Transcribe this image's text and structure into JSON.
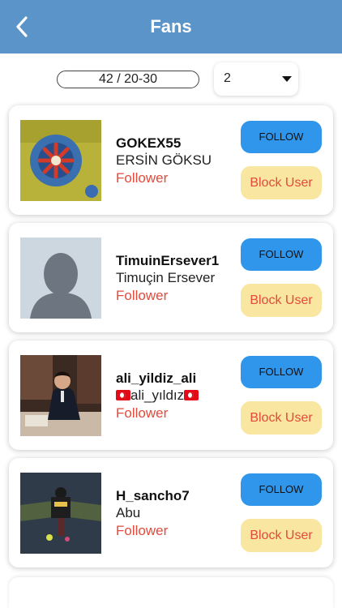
{
  "header": {
    "title": "Fans",
    "back_icon": "chevron-left-icon"
  },
  "pagination": {
    "range_text": "42 / 20-30",
    "selected_page": "2"
  },
  "fans": [
    {
      "username": "GOKEX55",
      "name": "ERSİN  GÖKSU",
      "role": "Follower",
      "follow_label": "FOLLOW",
      "block_label": "Block User"
    },
    {
      "username": "TimuinErsever1",
      "name": "Timuçin Ersever",
      "role": "Follower",
      "follow_label": "FOLLOW",
      "block_label": "Block User"
    },
    {
      "username": "ali_yildiz_ali",
      "name": "ali_yıldız",
      "role": "Follower",
      "follow_label": "FOLLOW",
      "block_label": "Block User"
    },
    {
      "username": "H_sancho7",
      "name": "Abu",
      "role": "Follower",
      "follow_label": "FOLLOW",
      "block_label": "Block User"
    }
  ],
  "colors": {
    "header_bg": "#5b94c8",
    "follow_bg": "#2f96ec",
    "block_bg": "#f9e6a0",
    "accent_red": "#e24a3c"
  }
}
